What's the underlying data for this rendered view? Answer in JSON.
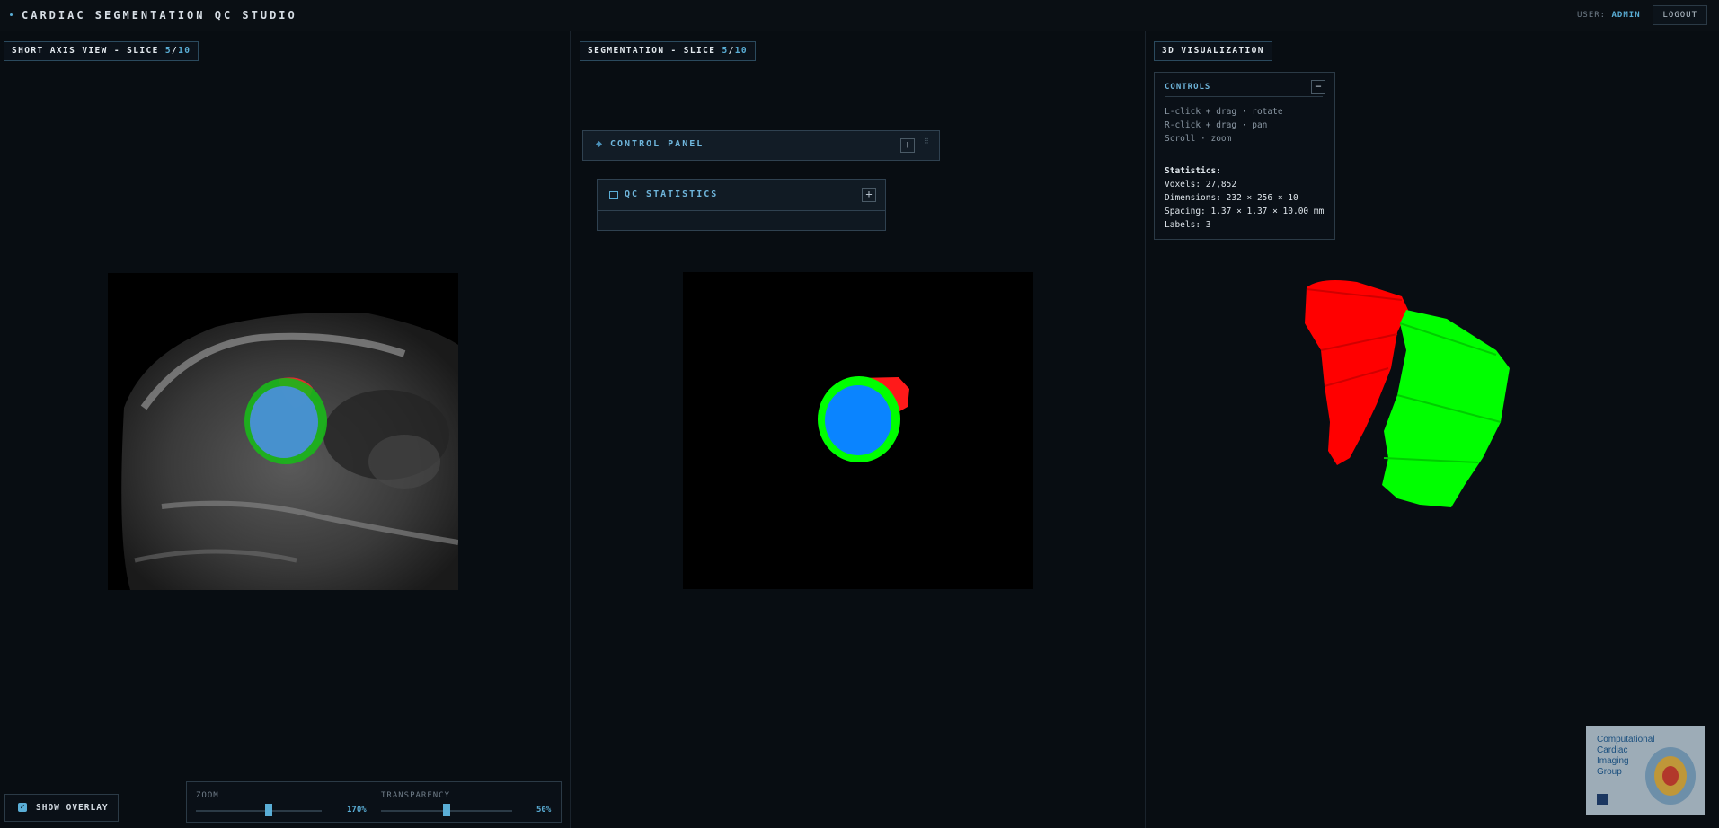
{
  "app": {
    "title": "CARDIAC SEGMENTATION QC STUDIO"
  },
  "header": {
    "user_prefix": "USER:",
    "user_name": "ADMIN",
    "logout_label": "LOGOUT"
  },
  "panels": {
    "short_axis": {
      "label": "SHORT AXIS VIEW - SLICE",
      "slice": "5",
      "total": "10"
    },
    "segmentation": {
      "label": "SEGMENTATION - SLICE",
      "slice": "5",
      "total": "10"
    },
    "viz": {
      "label": "3D VISUALIZATION"
    }
  },
  "control_panel": {
    "title": "CONTROL PANEL"
  },
  "qc_stats": {
    "title": "QC STATISTICS"
  },
  "controls": {
    "title": "CONTROLS",
    "hints": [
      "L-click + drag  ·  rotate",
      "R-click + drag  ·  pan",
      "Scroll  ·  zoom"
    ],
    "stats_title": "Statistics:",
    "stats": [
      "Voxels: 27,852",
      "Dimensions: 232 × 256 × 10",
      "Spacing: 1.37 × 1.37 × 10.00 mm",
      "Labels: 3"
    ]
  },
  "overlay": {
    "label": "SHOW OVERLAY",
    "checked": true
  },
  "sliders": {
    "zoom": {
      "label": "ZOOM",
      "value": "170%",
      "fraction": 0.58
    },
    "transparency": {
      "label": "TRANSPARENCY",
      "value": "50%",
      "fraction": 0.5
    }
  },
  "logo": {
    "text": "Computational\nCardiac\nImaging\nGroup"
  },
  "colors": {
    "accent": "#5aaed6",
    "lv_blood": "#0a84ff",
    "myocardium": "#00ff00",
    "rv": "#ff1a1a"
  }
}
